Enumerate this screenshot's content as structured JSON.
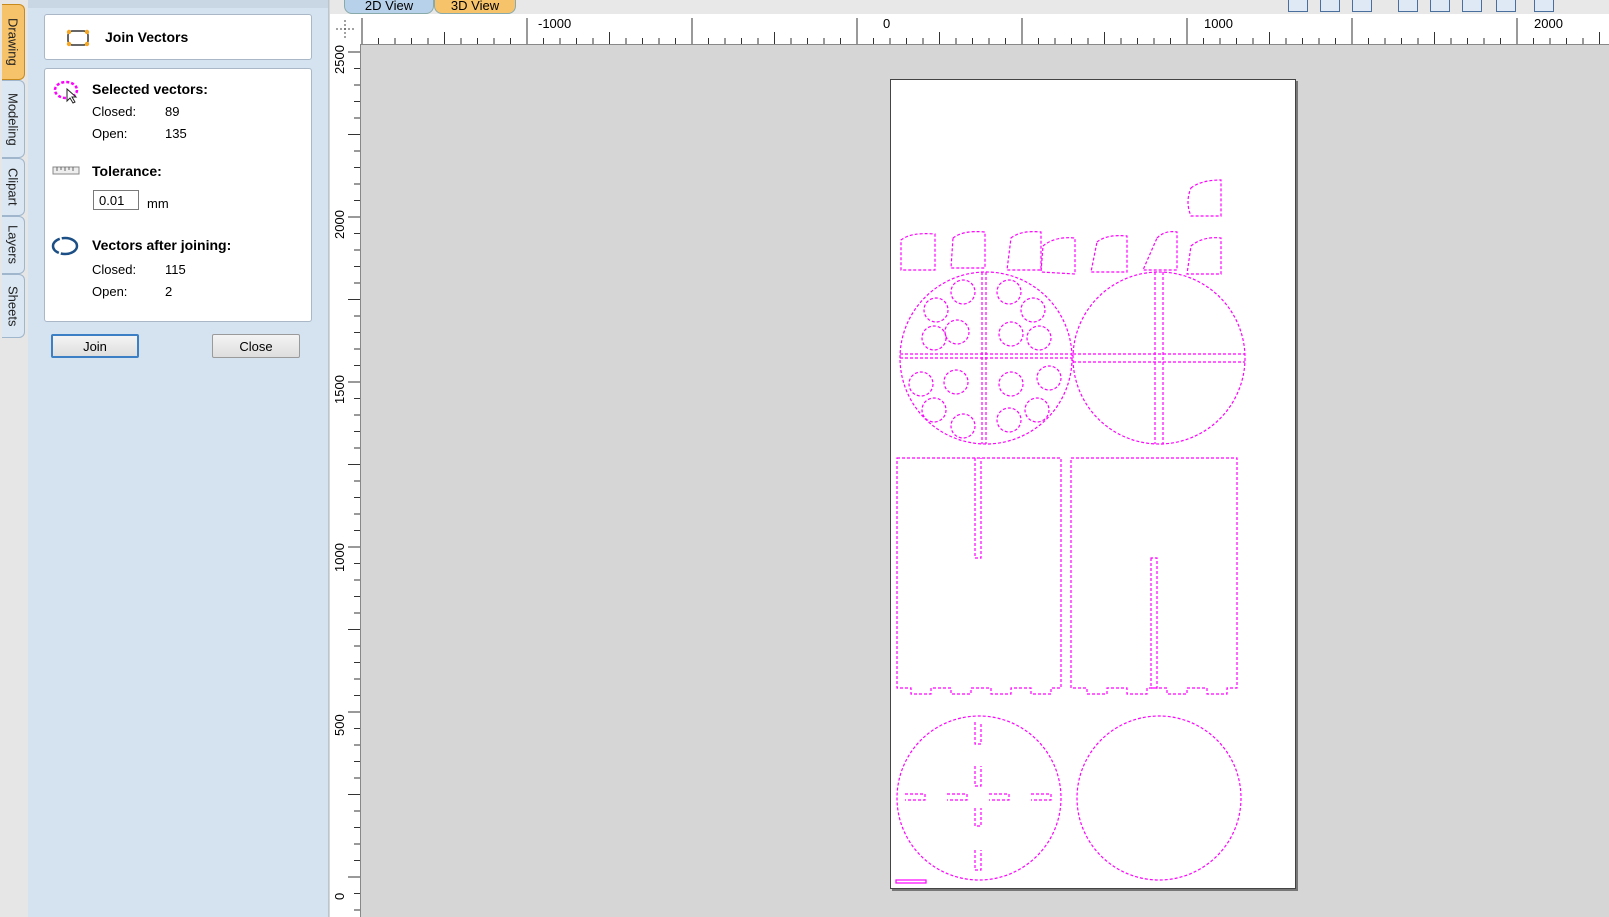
{
  "tabs": [
    "Drawing",
    "Modeling",
    "Clipart",
    "Layers",
    "Sheets"
  ],
  "view_tabs": [
    "2D View",
    "3D View"
  ],
  "panel": {
    "title": "Join Vectors",
    "selected_heading": "Selected vectors:",
    "selected_closed_label": "Closed:",
    "selected_closed_value": "89",
    "selected_open_label": "Open:",
    "selected_open_value": "135",
    "tolerance_heading": "Tolerance:",
    "tolerance_value": "0.01",
    "tolerance_unit": "mm",
    "after_heading": "Vectors after joining:",
    "after_closed_label": "Closed:",
    "after_closed_value": "115",
    "after_open_label": "Open:",
    "after_open_value": "2",
    "join_label": "Join",
    "close_label": "Close"
  },
  "ruler_h_labels": [
    "-1000",
    "0",
    "1000",
    "2000"
  ],
  "ruler_v_labels": [
    "2500",
    "2000",
    "1500",
    "1000",
    "500",
    "0"
  ],
  "colors": {
    "vector": "#ff00ff",
    "active_tab": "#f6c26a",
    "panel_bg": "#d5e3f0"
  }
}
